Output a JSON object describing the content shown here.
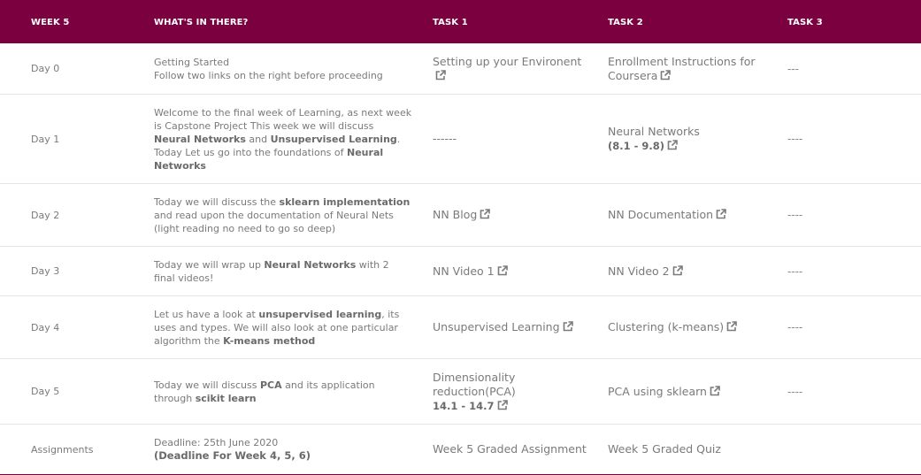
{
  "header": {
    "col_week": "WEEK 5",
    "col_contents": "WHAT'S IN THERE?",
    "col_task1": "TASK 1",
    "col_task2": "TASK 2",
    "col_task3": "TASK 3"
  },
  "rows": [
    {
      "day": "Day 0",
      "desc_line1": "Getting Started",
      "desc_line2": "Follow two links on the right before proceeding",
      "task1": "Setting up your Environent",
      "task2": "Enrollment Instructions for Coursera",
      "task3": "---"
    },
    {
      "day": "Day 1",
      "desc_a": "Welcome to the final week of Learning, as next week is Capstone Project This week we will discuss ",
      "desc_b": "Neural Networks",
      "desc_c": " and ",
      "desc_d": "Unsupervised Learning",
      "desc_e": ". Today Let us go into the foundations of ",
      "desc_f": "Neural Networks",
      "task1": "------",
      "task2": "Neural Networks",
      "task2_range": "(8.1 - 9.8)",
      "task3": "----"
    },
    {
      "day": "Day 2",
      "desc_a": "Today we will discuss the ",
      "desc_b": "sklearn implementation",
      "desc_c": " and read upon the documentation of Neural Nets (light reading no need to go so deep)",
      "task1": "NN Blog",
      "task2": "NN Documentation",
      "task3": "----"
    },
    {
      "day": "Day 3",
      "desc_a": "Today we will wrap up ",
      "desc_b": "Neural Networks",
      "desc_c": " with 2 final videos!",
      "task1": "NN Video 1",
      "task2": "NN Video 2",
      "task3": "----"
    },
    {
      "day": "Day 4",
      "desc_a": "Let us have a look at ",
      "desc_b": "unsupervised learning",
      "desc_c": ", its uses and types. We will also look at one particular algorithm the ",
      "desc_d": "K-means method",
      "task1": "Unsupervised Learning",
      "task2": "Clustering (k-means)",
      "task3": "----"
    },
    {
      "day": "Day 5",
      "desc_a": "Today we will discuss ",
      "desc_b": "PCA",
      "desc_c": " and its application through ",
      "desc_d": "scikit learn",
      "task1": "Dimensionality reduction(PCA)",
      "task1_range": "14.1 - 14.7",
      "task2": "PCA using sklearn",
      "task3": "----"
    },
    {
      "day": "Assignments",
      "desc_line1": "Deadline: 25th June 2020",
      "desc_line2": "(Deadline For Week 4, 5, 6)",
      "task1": "Week 5 Graded Assignment",
      "task2": "Week 5 Graded Quiz",
      "task3": ""
    }
  ],
  "colors": {
    "header_bg": "#7b0040",
    "header_text": "#ffffff",
    "body_text": "#7a7a7a"
  },
  "icons": {
    "link": "external-link-icon"
  }
}
